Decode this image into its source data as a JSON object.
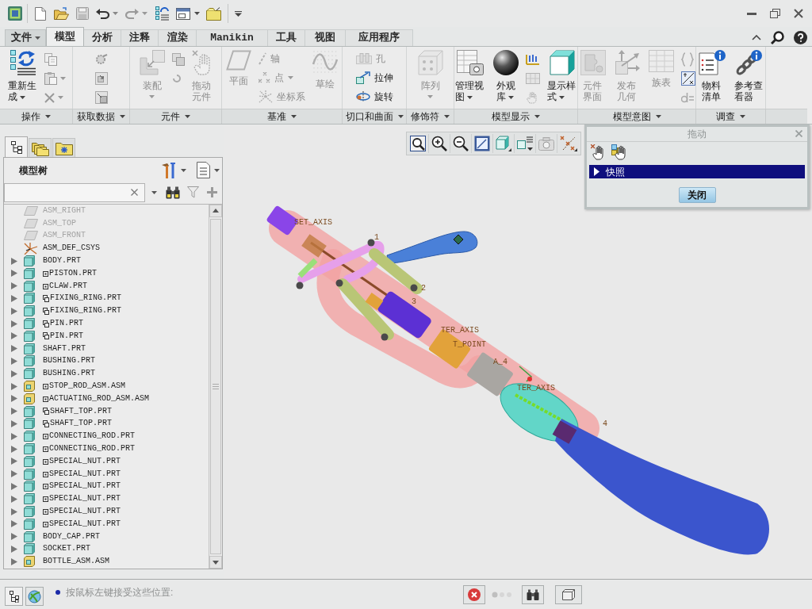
{
  "ribbon_tabs": [
    {
      "label": "文件",
      "kind": "menu",
      "selected": false
    },
    {
      "label": "模型",
      "kind": "tab",
      "selected": true
    },
    {
      "label": "分析",
      "kind": "tab",
      "selected": false
    },
    {
      "label": "注释",
      "kind": "tab",
      "selected": false
    },
    {
      "label": "渲染",
      "kind": "tab",
      "selected": false
    },
    {
      "label": "Manikin",
      "kind": "tab",
      "selected": false
    },
    {
      "label": "工具",
      "kind": "tab",
      "selected": false
    },
    {
      "label": "视图",
      "kind": "tab",
      "selected": false
    },
    {
      "label": "应用程序",
      "kind": "tab",
      "selected": false
    }
  ],
  "ribbon_groups": [
    {
      "label": "操作",
      "items": [
        {
          "label": "重新生成",
          "kind": "large",
          "dropdown": true,
          "disabled": false
        }
      ]
    },
    {
      "label": "获取数据"
    },
    {
      "label": "元件",
      "items": [
        {
          "label": "装配",
          "kind": "large",
          "dropdown": true,
          "disabled": true
        },
        {
          "label": "拖动元件",
          "kind": "large",
          "dropdown": false,
          "disabled": true
        }
      ]
    },
    {
      "label": "基准",
      "items": [
        {
          "label": "平面",
          "kind": "large",
          "dropdown": false,
          "disabled": true
        },
        {
          "label": "轴",
          "kind": "small",
          "dropdown": false,
          "disabled": true
        },
        {
          "label": "点",
          "kind": "small",
          "dropdown": true,
          "disabled": true
        },
        {
          "label": "坐标系",
          "kind": "small",
          "dropdown": false,
          "disabled": true
        },
        {
          "label": "草绘",
          "kind": "large",
          "dropdown": false,
          "disabled": true
        }
      ]
    },
    {
      "label": "切口和曲面",
      "items": [
        {
          "label": "孔",
          "kind": "small",
          "dropdown": false,
          "disabled": true
        },
        {
          "label": "拉伸",
          "kind": "small",
          "dropdown": false,
          "disabled": false
        },
        {
          "label": "旋转",
          "kind": "small",
          "dropdown": false,
          "disabled": false
        }
      ]
    },
    {
      "label": "修饰符",
      "items": [
        {
          "label": "阵列",
          "kind": "large",
          "dropdown": true,
          "disabled": true
        }
      ]
    },
    {
      "label": "模型显示",
      "items": [
        {
          "label": "管理视图",
          "kind": "large",
          "dropdown": true,
          "disabled": false
        },
        {
          "label": "外观库",
          "kind": "large",
          "dropdown": true,
          "disabled": false
        },
        {
          "label": "显示样式",
          "kind": "large",
          "dropdown": true,
          "disabled": false
        }
      ]
    },
    {
      "label": "模型意图",
      "items": [
        {
          "label": "元件界面",
          "kind": "large",
          "dropdown": false,
          "disabled": true
        },
        {
          "label": "发布几何",
          "kind": "large",
          "dropdown": false,
          "disabled": true
        },
        {
          "label": "族表",
          "kind": "large",
          "dropdown": false,
          "disabled": true
        }
      ]
    },
    {
      "label": "调查",
      "items": [
        {
          "label": "物料清单",
          "kind": "large",
          "dropdown": false,
          "disabled": false
        },
        {
          "label": "参考查看器",
          "kind": "large",
          "dropdown": false,
          "disabled": false
        }
      ]
    }
  ],
  "model_tree": {
    "tabs": [
      {
        "selected": true
      },
      {
        "selected": false
      },
      {
        "selected": false
      }
    ],
    "title": "模型树",
    "items": [
      {
        "name": "ASM_RIGHT",
        "kind": "datum_plane",
        "hidden": true
      },
      {
        "name": "ASM_TOP",
        "kind": "datum_plane",
        "hidden": true
      },
      {
        "name": "ASM_FRONT",
        "kind": "datum_plane",
        "hidden": true
      },
      {
        "name": "ASM_DEF_CSYS",
        "kind": "csys",
        "hidden": false
      },
      {
        "name": "BODY.PRT",
        "kind": "part",
        "hidden": false,
        "expanded": false
      },
      {
        "name": "PISTON.PRT",
        "kind": "part",
        "marker": {
          "kind": "square"
        },
        "hidden": false,
        "expanded": false
      },
      {
        "name": "CLAW.PRT",
        "kind": "part",
        "marker": {
          "kind": "square"
        },
        "hidden": false,
        "expanded": false
      },
      {
        "name": "FIXING_RING.PRT",
        "kind": "part",
        "marker": {
          "kind": "linked"
        },
        "hidden": false,
        "expanded": false
      },
      {
        "name": "FIXING_RING.PRT",
        "kind": "part",
        "marker": {
          "kind": "linked"
        },
        "hidden": false,
        "expanded": false
      },
      {
        "name": "PIN.PRT",
        "kind": "part",
        "marker": {
          "kind": "linked"
        },
        "hidden": false,
        "expanded": false
      },
      {
        "name": "PIN.PRT",
        "kind": "part",
        "marker": {
          "kind": "linked"
        },
        "hidden": false,
        "expanded": false
      },
      {
        "name": "SHAFT.PRT",
        "kind": "part",
        "hidden": false,
        "expanded": false
      },
      {
        "name": "BUSHING.PRT",
        "kind": "part",
        "hidden": false,
        "expanded": false
      },
      {
        "name": "BUSHING.PRT",
        "kind": "part",
        "hidden": false,
        "expanded": false
      },
      {
        "name": "STOP_ROD_ASM.ASM",
        "kind": "assembly",
        "marker": {
          "kind": "square"
        },
        "hidden": false,
        "expanded": false
      },
      {
        "name": "ACTUATING_ROD_ASM.ASM",
        "kind": "assembly",
        "marker": {
          "kind": "square"
        },
        "hidden": false,
        "expanded": false
      },
      {
        "name": "SHAFT_TOP.PRT",
        "kind": "part",
        "marker": {
          "kind": "linked"
        },
        "hidden": false,
        "expanded": false
      },
      {
        "name": "SHAFT_TOP.PRT",
        "kind": "part",
        "marker": {
          "kind": "linked"
        },
        "hidden": false,
        "expanded": false
      },
      {
        "name": "CONNECTING_ROD.PRT",
        "kind": "part",
        "marker": {
          "kind": "square"
        },
        "hidden": false,
        "expanded": false
      },
      {
        "name": "CONNECTING_ROD.PRT",
        "kind": "part",
        "marker": {
          "kind": "square"
        },
        "hidden": false,
        "expanded": false
      },
      {
        "name": "SPECIAL_NUT.PRT",
        "kind": "part",
        "marker": {
          "kind": "square"
        },
        "hidden": false,
        "expanded": false
      },
      {
        "name": "SPECIAL_NUT.PRT",
        "kind": "part",
        "marker": {
          "kind": "square"
        },
        "hidden": false,
        "expanded": false
      },
      {
        "name": "SPECIAL_NUT.PRT",
        "kind": "part",
        "marker": {
          "kind": "square"
        },
        "hidden": false,
        "expanded": false
      },
      {
        "name": "SPECIAL_NUT.PRT",
        "kind": "part",
        "marker": {
          "kind": "square"
        },
        "hidden": false,
        "expanded": false
      },
      {
        "name": "SPECIAL_NUT.PRT",
        "kind": "part",
        "marker": {
          "kind": "square"
        },
        "hidden": false,
        "expanded": false
      },
      {
        "name": "SPECIAL_NUT.PRT",
        "kind": "part",
        "marker": {
          "kind": "square"
        },
        "hidden": false,
        "expanded": false
      },
      {
        "name": "BODY_CAP.PRT",
        "kind": "part",
        "hidden": false,
        "expanded": false
      },
      {
        "name": "SOCKET.PRT",
        "kind": "part",
        "hidden": false,
        "expanded": false
      },
      {
        "name": "BOTTLE_ASM.ASM",
        "kind": "assembly",
        "hidden": false,
        "expanded": false
      }
    ]
  },
  "viewport": {
    "labels": [
      "SET_AXIS",
      "1",
      "2",
      "3",
      "TER_AXIS",
      "T_POINT",
      "A_4",
      "TER_AXIS",
      "4"
    ]
  },
  "drag_dialog": {
    "title": "拖动",
    "active": false,
    "sections": [
      {
        "label": "快照",
        "expanded": false
      }
    ],
    "buttons": [
      "关闭"
    ]
  },
  "status_bar": {
    "message": "按鼠标左键接受这些位置:"
  }
}
